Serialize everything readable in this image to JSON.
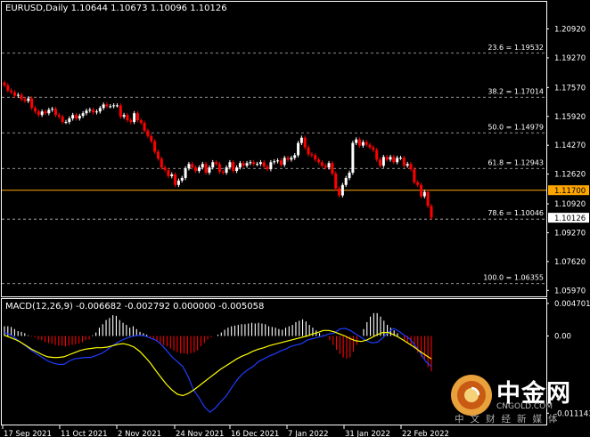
{
  "symbol": {
    "name": "EURUSD,Daily",
    "ohlc": "1.10644 1.10673 1.10096 1.10126"
  },
  "macd": {
    "label": "MACD(12,26,9) -0.006682 -0.002792 0.000000 -0.005058"
  },
  "price_axis": {
    "labels": [
      "1.20920",
      "1.19270",
      "1.17570",
      "1.15920",
      "1.14270",
      "1.12620",
      "1.10920",
      "1.09270",
      "1.07620",
      "1.05970"
    ]
  },
  "macd_axis": {
    "labels": [
      "0.004701",
      "0.00",
      "-0.011143"
    ]
  },
  "time_axis": {
    "labels": [
      "17 Sep 2021",
      "11 Oct 2021",
      "2 Nov 2021",
      "24 Nov 2021",
      "16 Dec 2021",
      "7 Jan 2022",
      "31 Jan 2022",
      "22 Feb 2022"
    ]
  },
  "fibonacci": [
    {
      "label": "23.6 = 1.19532",
      "price": 1.19532
    },
    {
      "label": "38.2 = 1.17014",
      "price": 1.17014
    },
    {
      "label": "50.0 = 1.14979",
      "price": 1.14979
    },
    {
      "label": "61.8 = 1.12943",
      "price": 1.12943
    },
    {
      "label": "78.6 = 1.10046",
      "price": 1.10046
    },
    {
      "label": "100.0 = 1.06355",
      "price": 1.06355
    }
  ],
  "hline": {
    "label": "1.11700",
    "price": 1.117,
    "color": "#ffa500"
  },
  "current_price": {
    "label": "1.10126",
    "price": 1.10126
  },
  "colors": {
    "background": "#000000",
    "bull": "#ffffff",
    "bear": "#ff0000",
    "signal": "#ffff00",
    "macd_line": "#1e3cff",
    "hline": "#ffa500",
    "grid": "#ffffff"
  },
  "watermark": {
    "title": "中金网",
    "url": "CNGOLD.COM",
    "subtitle": "中文财经新媒体",
    "logo": "gold-coin-logo"
  },
  "chart_data": [
    {
      "type": "candlestick",
      "title": "EURUSD,Daily",
      "ylim": [
        1.0597,
        1.2092
      ],
      "x_labels": [
        "17 Sep 2021",
        "11 Oct 2021",
        "2 Nov 2021",
        "24 Nov 2021",
        "16 Dec 2021",
        "7 Jan 2022",
        "31 Jan 2022",
        "22 Feb 2022"
      ],
      "closes": [
        1.177,
        1.174,
        1.173,
        1.171,
        1.1715,
        1.169,
        1.168,
        1.1695,
        1.164,
        1.162,
        1.16,
        1.162,
        1.161,
        1.163,
        1.1635,
        1.16,
        1.159,
        1.156,
        1.156,
        1.158,
        1.16,
        1.158,
        1.1595,
        1.161,
        1.1625,
        1.163,
        1.1615,
        1.162,
        1.164,
        1.166,
        1.165,
        1.165,
        1.1655,
        1.1655,
        1.159,
        1.16,
        1.157,
        1.156,
        1.161,
        1.157,
        1.1555,
        1.151,
        1.148,
        1.145,
        1.139,
        1.135,
        1.13,
        1.1285,
        1.125,
        1.126,
        1.12,
        1.1225,
        1.124,
        1.1295,
        1.132,
        1.13,
        1.128,
        1.13,
        1.132,
        1.127,
        1.13,
        1.133,
        1.132,
        1.1275,
        1.127,
        1.13,
        1.133,
        1.128,
        1.13,
        1.1325,
        1.131,
        1.1325,
        1.133,
        1.132,
        1.132,
        1.133,
        1.1305,
        1.129,
        1.133,
        1.1335,
        1.134,
        1.1315,
        1.1355,
        1.1345,
        1.1355,
        1.137,
        1.144,
        1.147,
        1.1415,
        1.1375,
        1.137,
        1.1345,
        1.133,
        1.131,
        1.13,
        1.1325,
        1.1265,
        1.118,
        1.114,
        1.12,
        1.124,
        1.127,
        1.144,
        1.146,
        1.1425,
        1.1445,
        1.143,
        1.1415,
        1.14,
        1.1345,
        1.131,
        1.136,
        1.1345,
        1.136,
        1.133,
        1.1355,
        1.1355,
        1.131,
        1.132,
        1.129,
        1.1215,
        1.12,
        1.1135,
        1.116,
        1.108,
        1.1013
      ]
    },
    {
      "type": "bar+line",
      "title": "MACD(12,26,9)",
      "ylim": [
        -0.011143,
        0.004701
      ],
      "histogram": [
        0.0014,
        0.0014,
        0.0013,
        0.001,
        0.0007,
        0.0006,
        0.0004,
        0.0001,
        -0.0001,
        -0.0002,
        -0.0005,
        -0.0006,
        -0.0009,
        -0.001,
        -0.0011,
        -0.0013,
        -0.0014,
        -0.0014,
        -0.0015,
        -0.0014,
        -0.0013,
        -0.0012,
        -0.0011,
        -0.0009,
        -0.0006,
        -0.0005,
        0.0001,
        0.0005,
        0.0012,
        0.0017,
        0.0023,
        0.0026,
        0.003,
        0.0029,
        0.0023,
        0.0019,
        0.0016,
        0.0012,
        0.0014,
        0.001,
        0.0006,
        0.0004,
        0.0002,
        -0.0002,
        -0.0005,
        -0.0008,
        -0.0011,
        -0.0013,
        -0.0015,
        -0.0018,
        -0.0021,
        -0.0023,
        -0.0025,
        -0.0025,
        -0.0026,
        -0.0025,
        -0.0024,
        -0.0021,
        -0.0015,
        -0.001,
        -0.0005,
        -0.0002,
        0.0,
        0.0002,
        0.0005,
        0.0009,
        0.0012,
        0.0014,
        0.0015,
        0.0016,
        0.0017,
        0.0017,
        0.0018,
        0.0019,
        0.0018,
        0.0019,
        0.0018,
        0.0017,
        0.0014,
        0.0013,
        0.0012,
        0.001,
        0.0009,
        0.0012,
        0.0014,
        0.0016,
        0.002,
        0.0022,
        0.0024,
        0.0021,
        0.0016,
        0.0012,
        0.0008,
        0.0004,
        0.0001,
        -0.0001,
        -0.0006,
        -0.0013,
        -0.002,
        -0.0026,
        -0.0031,
        -0.0033,
        -0.0031,
        -0.0023,
        -0.0013,
        -0.0001,
        0.001,
        0.002,
        0.0028,
        0.0033,
        0.0033,
        0.0028,
        0.0022,
        0.0016,
        0.0012,
        0.0008,
        0.0004,
        0.0,
        -0.0006,
        -0.001,
        -0.0014,
        -0.0018,
        -0.0024,
        -0.003,
        -0.0035,
        -0.0045,
        -0.0051
      ],
      "macd": [
        0.0005,
        0.0002,
        -0.0003,
        -0.0009,
        -0.0015,
        -0.0021,
        -0.0026,
        -0.0031,
        -0.0036,
        -0.0039,
        -0.0041,
        -0.0041,
        -0.0036,
        -0.0033,
        -0.0032,
        -0.0031,
        -0.0031,
        -0.0028,
        -0.0025,
        -0.002,
        -0.0014,
        -0.0009,
        -0.0005,
        -0.0002,
        0.0,
        0.0001,
        0.0,
        -0.0003,
        -0.0006,
        -0.0012,
        -0.0021,
        -0.003,
        -0.0037,
        -0.0044,
        -0.0059,
        -0.0078,
        -0.0089,
        -0.0102,
        -0.011,
        -0.0104,
        -0.0095,
        -0.0087,
        -0.0075,
        -0.0064,
        -0.0055,
        -0.0049,
        -0.0044,
        -0.0037,
        -0.0033,
        -0.0029,
        -0.0026,
        -0.0022,
        -0.0019,
        -0.0015,
        -0.0013,
        -0.0011,
        -0.0006,
        -0.0004,
        -0.0002,
        0.0,
        0.0003,
        0.0004,
        0.001,
        0.0011,
        0.0008,
        0.0003,
        -0.0002,
        -0.0007,
        -0.001,
        -0.0009,
        -0.0003,
        0.0005,
        0.0011,
        0.0007,
        0.0001,
        -0.0004,
        -0.0014,
        -0.0025,
        -0.0037,
        -0.0044
      ],
      "signal": [
        0.0001,
        -0.0002,
        -0.0005,
        -0.0009,
        -0.0014,
        -0.0019,
        -0.0023,
        -0.0027,
        -0.003,
        -0.0031,
        -0.0031,
        -0.003,
        -0.0027,
        -0.0024,
        -0.0021,
        -0.0019,
        -0.0018,
        -0.0017,
        -0.0017,
        -0.0016,
        -0.0014,
        -0.0012,
        -0.0011,
        -0.0013,
        -0.0016,
        -0.0022,
        -0.003,
        -0.0039,
        -0.005,
        -0.006,
        -0.007,
        -0.0078,
        -0.0084,
        -0.0086,
        -0.0083,
        -0.0078,
        -0.0072,
        -0.0066,
        -0.006,
        -0.0054,
        -0.0048,
        -0.0043,
        -0.0038,
        -0.0033,
        -0.0029,
        -0.0026,
        -0.0022,
        -0.0019,
        -0.0017,
        -0.0014,
        -0.0012,
        -0.001,
        -0.0008,
        -0.0006,
        -0.0004,
        -0.0002,
        0.0,
        0.0003,
        0.0005,
        0.0008,
        0.0008,
        0.0006,
        0.0003,
        0.0,
        -0.0004,
        -0.0007,
        -0.0008,
        -0.0006,
        -0.0002,
        0.0002,
        0.0005,
        0.0005,
        0.0002,
        -0.0002,
        -0.0007,
        -0.0012,
        -0.0017,
        -0.0023,
        -0.0028,
        -0.0033
      ]
    }
  ]
}
